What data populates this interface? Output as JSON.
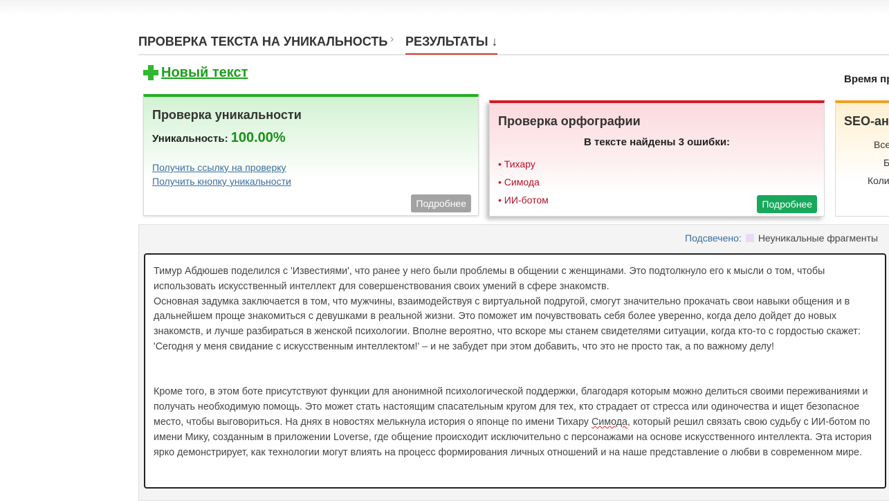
{
  "breadcrumbs": {
    "step1": "ПРОВЕРКА ТЕКСТА НА УНИКАЛЬНОСТЬ",
    "separator": "›",
    "step2": "РЕЗУЛЬТАТЫ ↓"
  },
  "new_text": {
    "label": "Новый текст"
  },
  "time_label": "Время пр",
  "uniqueness": {
    "title": "Проверка уникальности",
    "label": "Уникальность:",
    "value": "100.00%",
    "link_check": "Получить ссылку на проверку",
    "link_button": "Получить кнопку уникальности",
    "more": "Подробнее"
  },
  "spelling": {
    "title": "Проверка орфографии",
    "summary": "В тексте найдены 3 ошибки:",
    "errors": [
      "Тихару",
      "Симода",
      "ИИ-ботом"
    ],
    "more": "Подробнее"
  },
  "seo": {
    "title": "SEO-ан",
    "lines": [
      "Все",
      "Б",
      "Коли"
    ]
  },
  "highlight": {
    "label": "Подсвечено:",
    "legend": "Неуникальные фрагменты"
  },
  "text": {
    "p1": "Тимур Абдюшев поделился с 'Известиями', что ранее у него были проблемы в общении с женщинами. Это подтолкнуло его к мысли о том, чтобы использовать искусственный интеллект для совершенствования своих умений в сфере знакомств.",
    "p2": "Основная задумка заключается в том, что мужчины, взаимодействуя с виртуальной подругой, смогут значительно прокачать свои навыки общения и в дальнейшем проще знакомиться с девушками в реальной жизни. Это поможет им почувствовать себя более уверенно, когда дело дойдет до новых знакомств, и лучше разбираться в женской психологии. Вполне вероятно, что вскоре мы станем свидетелями ситуации, когда кто-то с гордостью скажет: 'Сегодня у меня свидание с искусственным интеллектом!' – и не забудет при этом добавить, что это не просто так, а по важному делу!",
    "p3_a": "Кроме того, в этом боте присутствуют функции для анонимной психологической поддержки, благодаря которым можно делиться своими переживаниями и получать необходимую помощь. Это может стать настоящим спасательным кругом для тех, кто страдает от стресса или одиночества и ищет безопасное место, чтобы выговориться. На днях в новостях мелькнула история о японце по имени Тихару ",
    "p3_err": "Симода",
    "p3_b": ", который решил связать свою судьбу с ИИ-ботом по имени Мику, созданным в приложении Loverse, где общение происходит исключительно с персонажами на основе искусственного интеллекта. Эта история ярко демонстрирует, как технологии могут влиять на процесс формирования личных отношений и на наше представление о любви в современном мире."
  },
  "colors": {
    "accent_green": "#20b020",
    "accent_red": "#d31a2a",
    "accent_orange": "#f0a020",
    "link_blue": "#3b6e9e"
  }
}
